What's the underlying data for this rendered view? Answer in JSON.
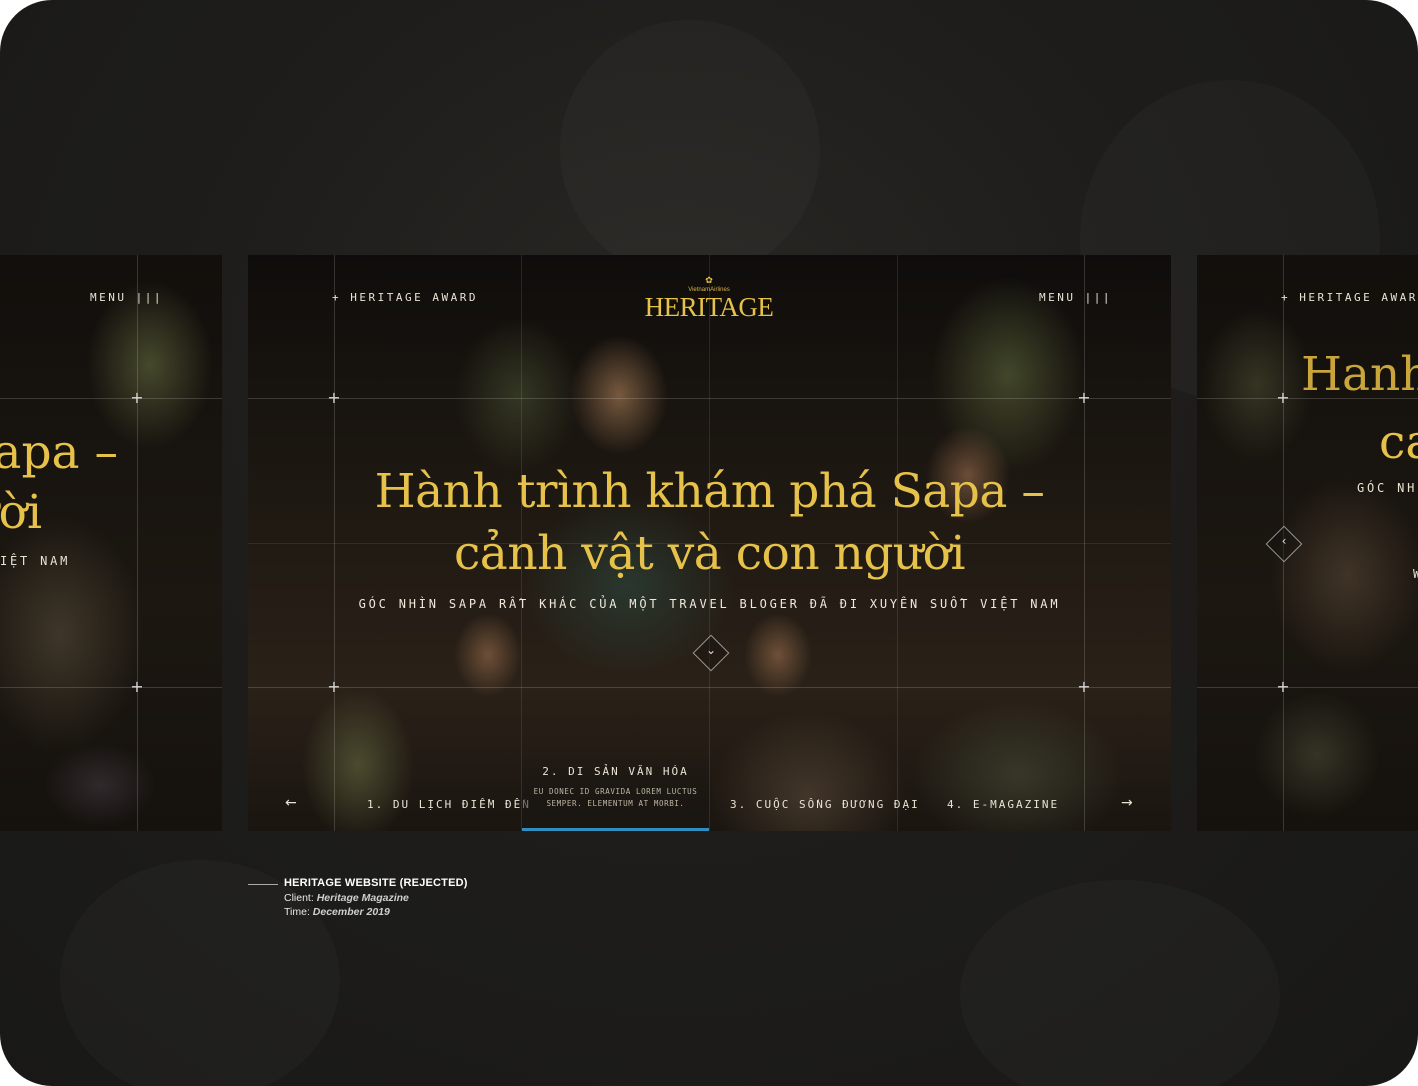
{
  "showcase": {
    "main_slide": {
      "eyebrow": "+ HERITAGE AWARD",
      "logo_airline": "VietnamAirlines",
      "logo_name": "HERITAGE",
      "menu_label": "MENU |||",
      "headline_line1": "Hành trình khám phá Sapa –",
      "headline_line2": "cảnh vật và con người",
      "subheadline": "GÓC NHÌN SAPA RẤT KHÁC CỦA MỘT TRAVEL BLOGER ĐÃ ĐI XUYÊN SUỐT VIỆT NAM",
      "prev_arrow": "←",
      "next_arrow": "→",
      "chapters": [
        {
          "label": "1. DU LỊCH ĐIỂM ĐẾN"
        },
        {
          "label": "2. DI SẢN VĂN HÓA",
          "desc_line1": "EU DONEC ID GRAVIDA LOREM LUCTUS",
          "desc_line2": "SEMPER. ELEMENTUM AT MORBI.",
          "active": true
        },
        {
          "label": "3. CUỘC SỐNG ĐƯƠNG ĐẠI"
        },
        {
          "label": "4. E-MAGAZINE"
        }
      ],
      "accent_color": "#e7c24a",
      "active_bar_color": "#2f8fc0"
    },
    "left_slide": {
      "menu_label": "MENU |||",
      "headline_line1": "apa –",
      "headline_line2": "ười",
      "subheadline": "IỆT NAM"
    },
    "right_slide": {
      "eyebrow": "+ HERITAGE AWARD",
      "headline_line1": "Hanh",
      "headline_line2": "ca",
      "subheadline": "GÓC NHÌ",
      "extra": "W"
    }
  },
  "caption": {
    "title": "HERITAGE WEBSITE (REJECTED)",
    "client_label": "Client:",
    "client_value": "Heritage Magazine",
    "time_label": "Time:",
    "time_value": "December 2019"
  }
}
